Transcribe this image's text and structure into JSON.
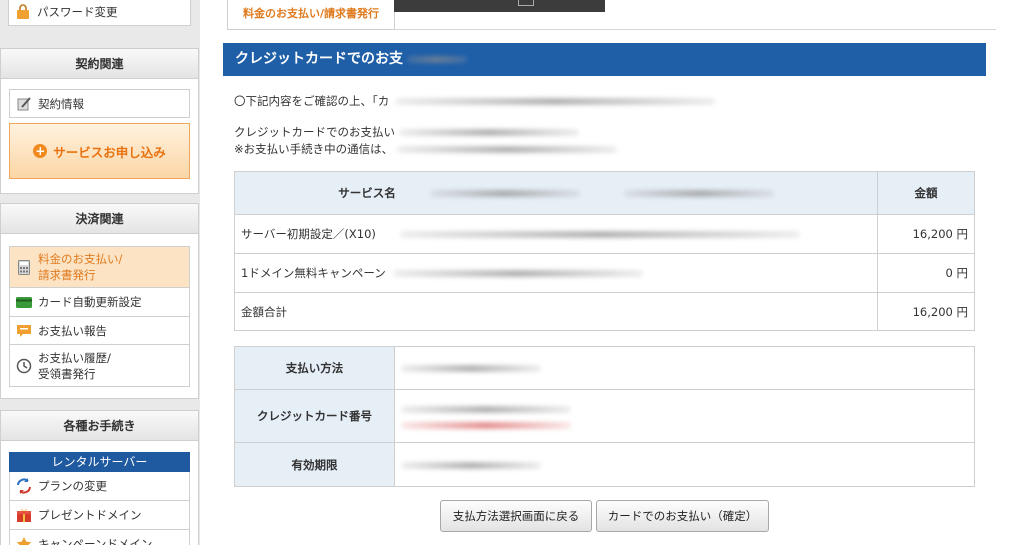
{
  "sidebar": {
    "password_change": "パスワード変更",
    "contract_head": "契約関連",
    "contract_info": "契約情報",
    "service_apply": "サービスお申し込み",
    "payment_head": "決済関連",
    "payment_items": [
      {
        "line1": "料金のお支払い/",
        "line2": "請求書発行"
      },
      {
        "line1": "カード自動更新設定"
      },
      {
        "line1": "お支払い報告"
      },
      {
        "line1": "お支払い履歴/",
        "line2": "受領書発行"
      }
    ],
    "procedures_head": "各種お手続き",
    "rental_head": "レンタルサーバー",
    "procedure_items": [
      "プランの変更",
      "プレゼントドメイン",
      "キャンペーンドメイン"
    ]
  },
  "main": {
    "tab_label": "料金のお支払い/請求書発行",
    "title": "クレジットカードでのお支",
    "note1": "〇下記内容をご確認の上、「カ",
    "note2": "クレジットカードでのお支払い",
    "note3": "※お支払い手続き中の通信は、",
    "service_table": {
      "header_service": "サービス名",
      "header_amount": "金額",
      "rows": [
        {
          "name": "サーバー初期設定／(X10)",
          "amount": "16,200 円"
        },
        {
          "name": "1ドメイン無料キャンペーン",
          "amount": "0 円"
        }
      ],
      "total_label": "金額合計",
      "total_amount": "16,200 円"
    },
    "payment_table": {
      "method_label": "支払い方法",
      "card_number_label": "クレジットカード番号",
      "expiry_label": "有効期限"
    },
    "back_button": "支払方法選択画面に戻る",
    "confirm_button": "カードでのお支払い（確定）"
  }
}
